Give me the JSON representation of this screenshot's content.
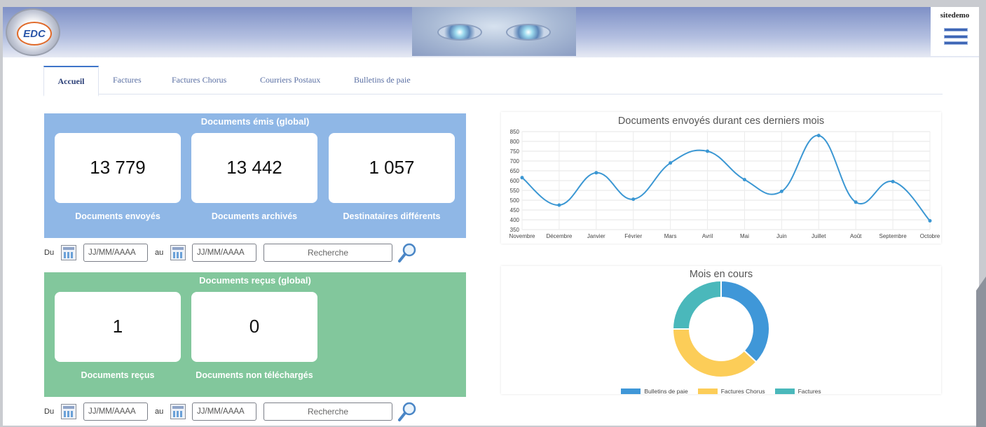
{
  "header": {
    "logo_text": "EDC",
    "username": "sitedemo"
  },
  "tabs": [
    {
      "label": "Accueil",
      "active": true
    },
    {
      "label": "Factures",
      "active": false
    },
    {
      "label": "Factures Chorus",
      "active": false
    },
    {
      "label": "Courriers Postaux",
      "active": false
    },
    {
      "label": "Bulletins de paie",
      "active": false
    }
  ],
  "emitted": {
    "title": "Documents émis (global)",
    "cards": [
      {
        "value": "13 779",
        "label": "Documents envoyés"
      },
      {
        "value": "13 442",
        "label": "Documents archivés"
      },
      {
        "value": "1 057",
        "label": "Destinataires différents"
      }
    ]
  },
  "received": {
    "title": "Documents reçus (global)",
    "cards": [
      {
        "value": "1",
        "label": "Documents reçus"
      },
      {
        "value": "0",
        "label": "Documents non téléchargés"
      }
    ]
  },
  "filters": {
    "from_label": "Du",
    "to_label": "au",
    "date_placeholder": "JJ/MM/AAAA",
    "search_placeholder": "Recherche"
  },
  "colors": {
    "emitted_panel": "#8fb7e6",
    "received_panel": "#82c79c",
    "line": "#3b97d3",
    "bulletins": "#3f97d8",
    "chorus": "#fccd58",
    "factures": "#4ab8bb"
  },
  "chart_data": [
    {
      "type": "line",
      "title": "Documents envoyés durant ces derniers mois",
      "categories": [
        "Novembre",
        "Décembre",
        "Janvier",
        "Février",
        "Mars",
        "Avril",
        "Mai",
        "Juin",
        "Juillet",
        "Août",
        "Septembre",
        "Octobre"
      ],
      "values": [
        615,
        475,
        640,
        505,
        690,
        750,
        605,
        545,
        830,
        490,
        595,
        395
      ],
      "ylim": [
        350,
        850
      ],
      "yticks": [
        850,
        800,
        750,
        700,
        650,
        600,
        550,
        500,
        450,
        400,
        350
      ],
      "grid": true
    },
    {
      "type": "pie",
      "title": "Mois en cours",
      "labels": [
        "Bulletins de paie",
        "Factures Chorus",
        "Factures"
      ],
      "values": [
        37,
        38,
        25
      ],
      "legend": "bottom"
    }
  ]
}
